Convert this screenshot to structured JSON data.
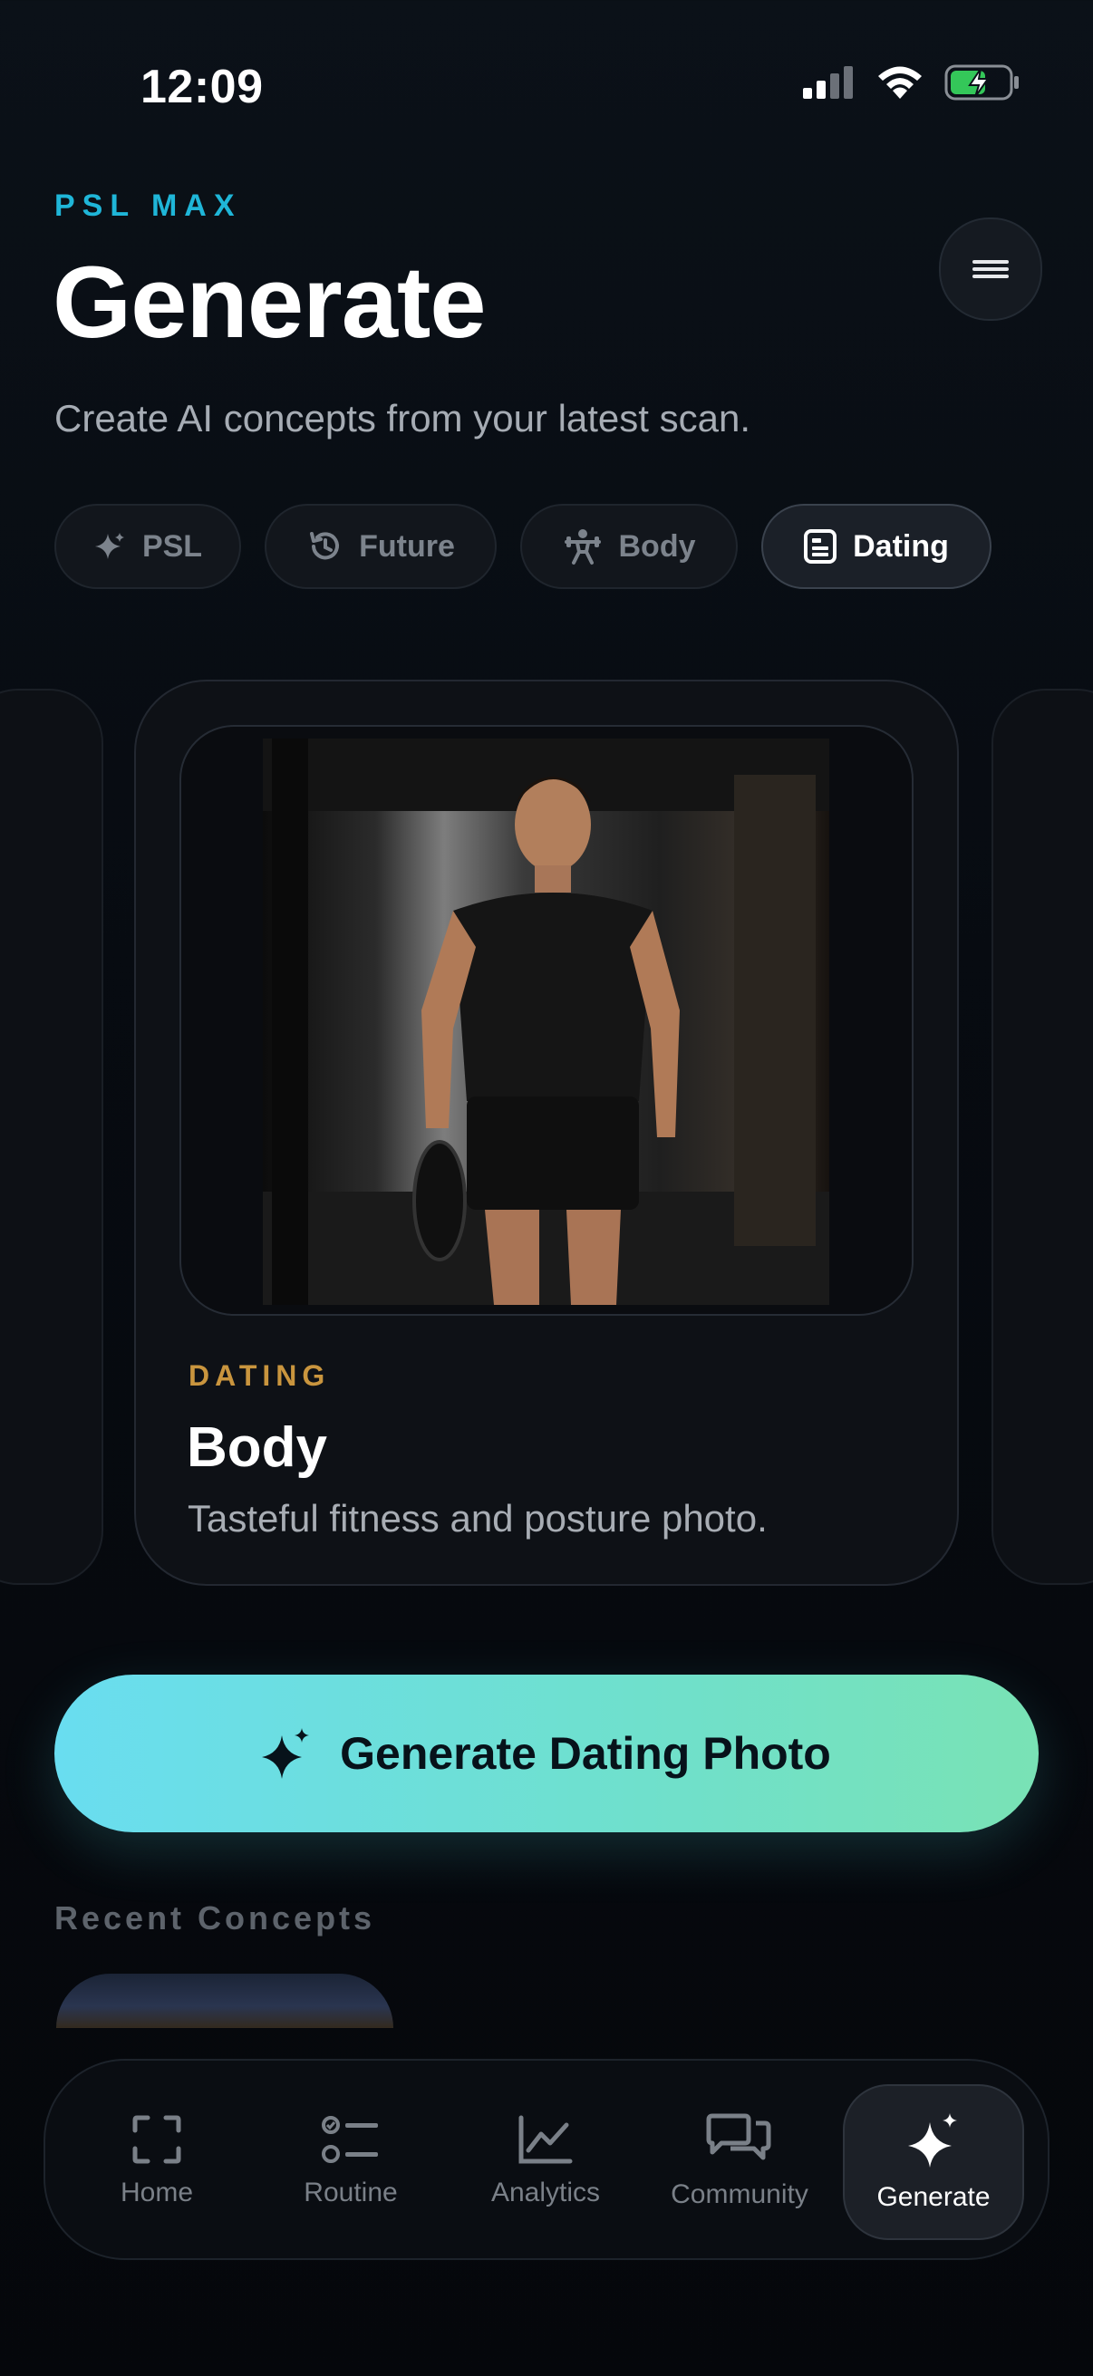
{
  "status_bar": {
    "time": "12:09"
  },
  "header": {
    "brand": "PSL MAX",
    "title": "Generate",
    "subtitle": "Create AI concepts from your latest scan."
  },
  "chips": [
    {
      "label": "PSL",
      "icon": "sparkle-icon"
    },
    {
      "label": "Future",
      "icon": "history-icon"
    },
    {
      "label": "Body",
      "icon": "weightlifter-icon"
    },
    {
      "label": "Dating",
      "icon": "profile-card-icon",
      "active": true
    }
  ],
  "card": {
    "category": "DATING",
    "title": "Body",
    "description": "Tasteful fitness and posture photo."
  },
  "cta": {
    "label": "Generate Dating Photo"
  },
  "recent": {
    "heading": "Recent Concepts"
  },
  "tabs": [
    {
      "label": "Home",
      "icon": "scan-frame-icon"
    },
    {
      "label": "Routine",
      "icon": "checklist-icon"
    },
    {
      "label": "Analytics",
      "icon": "chart-line-icon"
    },
    {
      "label": "Community",
      "icon": "chat-bubbles-icon"
    },
    {
      "label": "Generate",
      "icon": "sparkles-icon",
      "active": true
    }
  ],
  "colors": {
    "brand_accent": "#1fb6d8",
    "category_accent": "#c9953e",
    "cta_gradient_start": "#69ddf0",
    "cta_gradient_end": "#79e2b5",
    "battery_green": "#34c759"
  }
}
